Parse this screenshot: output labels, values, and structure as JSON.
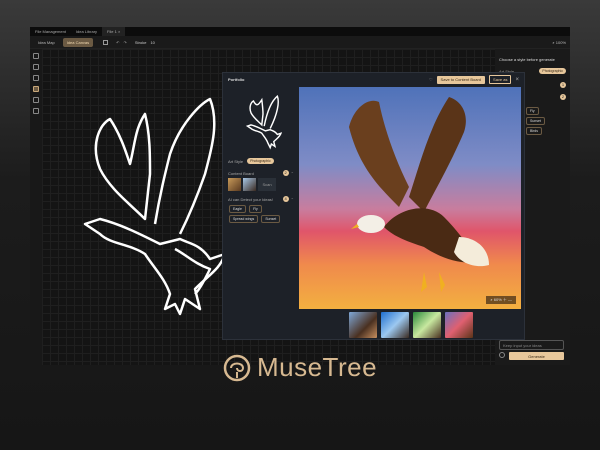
{
  "tabs": [
    "File Management",
    "Idea Library",
    "File 1"
  ],
  "tab_close": "×",
  "toolbar": {
    "idea_map": "Idea Map",
    "idea_canvas": "Idea Canvas",
    "stroke_label": "Stroke",
    "stroke_value": "10"
  },
  "zoom": "100%",
  "right_panel": {
    "title": "Choose a style before generate",
    "art_style_label": "Art Style",
    "art_style_value": "Photographic",
    "badge1": "1",
    "badge2": "2",
    "chips": [
      "Fly",
      "Sunset",
      "Birds"
    ],
    "input_placeholder": "Keep input your ideas",
    "generate": "Generate"
  },
  "dialog": {
    "title": "Portfolio",
    "save_content_board": "Save to Content Board",
    "save_as": "Save as",
    "close": "×",
    "art_style_label": "Art Style",
    "art_style_value": "Photographic",
    "content_board_label": "Content Board",
    "content_board_badge": "2",
    "scan": "Scan",
    "detect_label": "AI can Detect your Ideas!",
    "detect_badge": "4",
    "tags": [
      "Eagle",
      "Fly",
      "Spread wings",
      "Sunset"
    ],
    "zoom_value": "60%"
  },
  "brand": {
    "name": "MuseTree"
  },
  "colors": {
    "accent": "#e7c79b",
    "bg": "#141414"
  }
}
